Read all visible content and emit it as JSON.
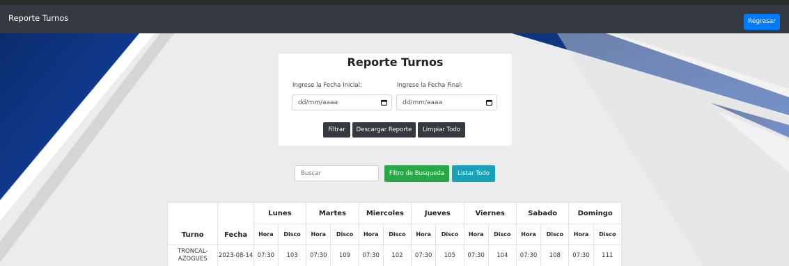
{
  "navbar": {
    "title": "Reporte Turnos",
    "back_label": "Regresar"
  },
  "form": {
    "title": "Reporte Turnos",
    "start_label": "Ingrese la Fecha Inicial:",
    "end_label": "Ingrese la Fecha Final:",
    "start_placeholder": "dd/mm/aaaa",
    "end_placeholder": "dd/mm/aaaa",
    "filter_label": "Filtrar",
    "download_label": "Descargar Reporte",
    "clear_label": "Limpiar Todo"
  },
  "search": {
    "placeholder": "Buscar",
    "filter_label": "Filtro de Busqueda",
    "list_all_label": "Listar Todo"
  },
  "table": {
    "turno_header": "Turno",
    "fecha_header": "Fecha",
    "days": [
      "Lunes",
      "Martes",
      "Miercoles",
      "Jueves",
      "Viernes",
      "Sabado",
      "Domingo"
    ],
    "hora_label": "Hora",
    "disco_label": "Disco",
    "rows": [
      {
        "turno": "TRONCAL-AZOGUES",
        "fecha": "2023-08-14",
        "cells": [
          "07:30",
          "103",
          "07:30",
          "109",
          "07:30",
          "102",
          "07:30",
          "105",
          "07:30",
          "104",
          "07:30",
          "108",
          "07:30",
          "111"
        ]
      }
    ]
  },
  "colors": {
    "navbar": "#343a40",
    "primary": "#007bff",
    "success": "#28a745",
    "info": "#17a2b8",
    "accent_blue": "#0d3a8c"
  }
}
